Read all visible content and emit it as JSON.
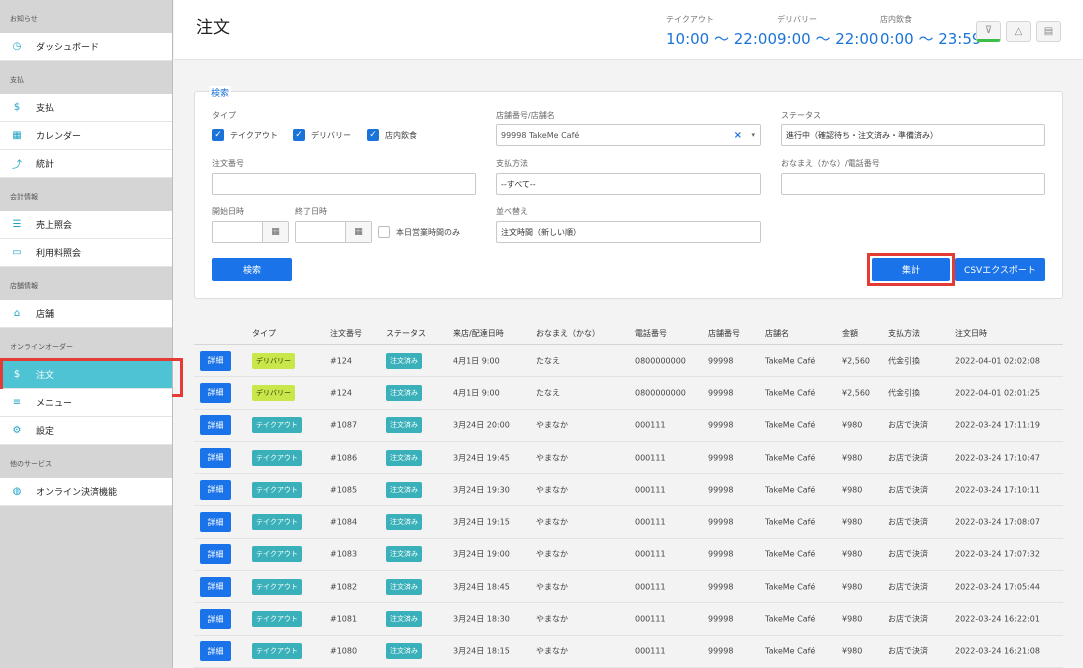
{
  "sidebar": {
    "sections": [
      {
        "label": "お知らせ",
        "items": [
          {
            "label": "ダッシュボード",
            "icon": "dashboard-icon",
            "glyph": "◷"
          }
        ]
      },
      {
        "label": "支払",
        "items": [
          {
            "label": "支払",
            "icon": "dollar-icon",
            "glyph": "$"
          },
          {
            "label": "カレンダー",
            "icon": "calendar-icon",
            "glyph": "▦"
          },
          {
            "label": "統計",
            "icon": "chart-icon",
            "glyph": "⤴"
          }
        ]
      },
      {
        "label": "会計情報",
        "items": [
          {
            "label": "売上照会",
            "icon": "list-icon",
            "glyph": "☰"
          },
          {
            "label": "利用料照会",
            "icon": "card-icon",
            "glyph": "▭"
          }
        ]
      },
      {
        "label": "店舗情報",
        "items": [
          {
            "label": "店舗",
            "icon": "home-icon",
            "glyph": "⌂"
          }
        ]
      },
      {
        "label": "オンラインオーダー",
        "items": [
          {
            "label": "注文",
            "icon": "dollar-icon",
            "glyph": "$",
            "active": true
          },
          {
            "label": "メニュー",
            "icon": "menu-icon",
            "glyph": "≡"
          },
          {
            "label": "設定",
            "icon": "gear-icon",
            "glyph": "⚙"
          }
        ]
      },
      {
        "label": "他のサービス",
        "items": [
          {
            "label": "オンライン決済機能",
            "icon": "globe-icon",
            "glyph": "◍"
          }
        ]
      }
    ]
  },
  "header": {
    "title": "注文",
    "hours": [
      {
        "label": "テイクアウト",
        "value": "10:00 ～ 22:00"
      },
      {
        "label": "デリバリー",
        "value": "9:00 ～ 22:00"
      },
      {
        "label": "店内飲食",
        "value": "0:00 ～ 23:59"
      }
    ],
    "buttons": [
      {
        "icon": "filter-icon",
        "glyph": "⊽"
      },
      {
        "icon": "bell-icon",
        "glyph": "△"
      },
      {
        "icon": "list-icon",
        "glyph": "▤"
      }
    ]
  },
  "search": {
    "title": "検索",
    "type_label": "タイプ",
    "type_options": [
      {
        "label": "テイクアウト",
        "checked": true
      },
      {
        "label": "デリバリー",
        "checked": true
      },
      {
        "label": "店内飲食",
        "checked": true
      }
    ],
    "store_label": "店舗番号/店舗名",
    "store_value": "99998 TakeMe Café",
    "status_label": "ステータス",
    "status_value": "進行中（確認待ち・注文済み・準備済み）",
    "order_no_label": "注文番号",
    "order_no_value": "",
    "payment_label": "支払方法",
    "payment_value": "--すべて--",
    "name_label": "おなまえ（かな）/電話番号",
    "name_value": "",
    "start_label": "開始日時",
    "end_label": "終了日時",
    "today_only_label": "本日営業時間のみ",
    "sort_label": "並べ替え",
    "sort_value": "注文時間（新しい順）",
    "search_button": "検索",
    "aggregate_button": "集計",
    "csv_button": "CSVエクスポート"
  },
  "table": {
    "headers": [
      "タイプ",
      "注文番号",
      "ステータス",
      "来店/配達日時",
      "おなまえ（かな）",
      "電話番号",
      "店舗番号",
      "店舗名",
      "金額",
      "支払方法",
      "注文日時"
    ],
    "detail_label": "詳細",
    "rows": [
      {
        "type": "デリバリー",
        "kind": "deliv",
        "order_no": "#124",
        "status": "注文済み",
        "visit": "4月1日 9:00",
        "name": "たなえ",
        "phone": "0800000000",
        "store_no": "99998",
        "store": "TakeMe Café",
        "amount": "¥2,560",
        "payment": "代金引換",
        "ordered": "2022-04-01 02:02:08"
      },
      {
        "type": "デリバリー",
        "kind": "deliv",
        "order_no": "#124",
        "status": "注文済み",
        "visit": "4月1日 9:00",
        "name": "たなえ",
        "phone": "0800000000",
        "store_no": "99998",
        "store": "TakeMe Café",
        "amount": "¥2,560",
        "payment": "代金引換",
        "ordered": "2022-04-01 02:01:25"
      },
      {
        "type": "テイクアウト",
        "kind": "take",
        "order_no": "#1087",
        "status": "注文済み",
        "visit": "3月24日 20:00",
        "name": "やまなか",
        "phone": "000111",
        "store_no": "99998",
        "store": "TakeMe Café",
        "amount": "¥980",
        "payment": "お店で決済",
        "ordered": "2022-03-24 17:11:19"
      },
      {
        "type": "テイクアウト",
        "kind": "take",
        "order_no": "#1086",
        "status": "注文済み",
        "visit": "3月24日 19:45",
        "name": "やまなか",
        "phone": "000111",
        "store_no": "99998",
        "store": "TakeMe Café",
        "amount": "¥980",
        "payment": "お店で決済",
        "ordered": "2022-03-24 17:10:47"
      },
      {
        "type": "テイクアウト",
        "kind": "take",
        "order_no": "#1085",
        "status": "注文済み",
        "visit": "3月24日 19:30",
        "name": "やまなか",
        "phone": "000111",
        "store_no": "99998",
        "store": "TakeMe Café",
        "amount": "¥980",
        "payment": "お店で決済",
        "ordered": "2022-03-24 17:10:11"
      },
      {
        "type": "テイクアウト",
        "kind": "take",
        "order_no": "#1084",
        "status": "注文済み",
        "visit": "3月24日 19:15",
        "name": "やまなか",
        "phone": "000111",
        "store_no": "99998",
        "store": "TakeMe Café",
        "amount": "¥980",
        "payment": "お店で決済",
        "ordered": "2022-03-24 17:08:07"
      },
      {
        "type": "テイクアウト",
        "kind": "take",
        "order_no": "#1083",
        "status": "注文済み",
        "visit": "3月24日 19:00",
        "name": "やまなか",
        "phone": "000111",
        "store_no": "99998",
        "store": "TakeMe Café",
        "amount": "¥980",
        "payment": "お店で決済",
        "ordered": "2022-03-24 17:07:32"
      },
      {
        "type": "テイクアウト",
        "kind": "take",
        "order_no": "#1082",
        "status": "注文済み",
        "visit": "3月24日 18:45",
        "name": "やまなか",
        "phone": "000111",
        "store_no": "99998",
        "store": "TakeMe Café",
        "amount": "¥980",
        "payment": "お店で決済",
        "ordered": "2022-03-24 17:05:44"
      },
      {
        "type": "テイクアウト",
        "kind": "take",
        "order_no": "#1081",
        "status": "注文済み",
        "visit": "3月24日 18:30",
        "name": "やまなか",
        "phone": "000111",
        "store_no": "99998",
        "store": "TakeMe Café",
        "amount": "¥980",
        "payment": "お店で決済",
        "ordered": "2022-03-24 16:22:01"
      },
      {
        "type": "テイクアウト",
        "kind": "take",
        "order_no": "#1080",
        "status": "注文済み",
        "visit": "3月24日 18:15",
        "name": "やまなか",
        "phone": "000111",
        "store_no": "99998",
        "store": "TakeMe Café",
        "amount": "¥980",
        "payment": "お店で決済",
        "ordered": "2022-03-24 16:21:08"
      }
    ]
  }
}
